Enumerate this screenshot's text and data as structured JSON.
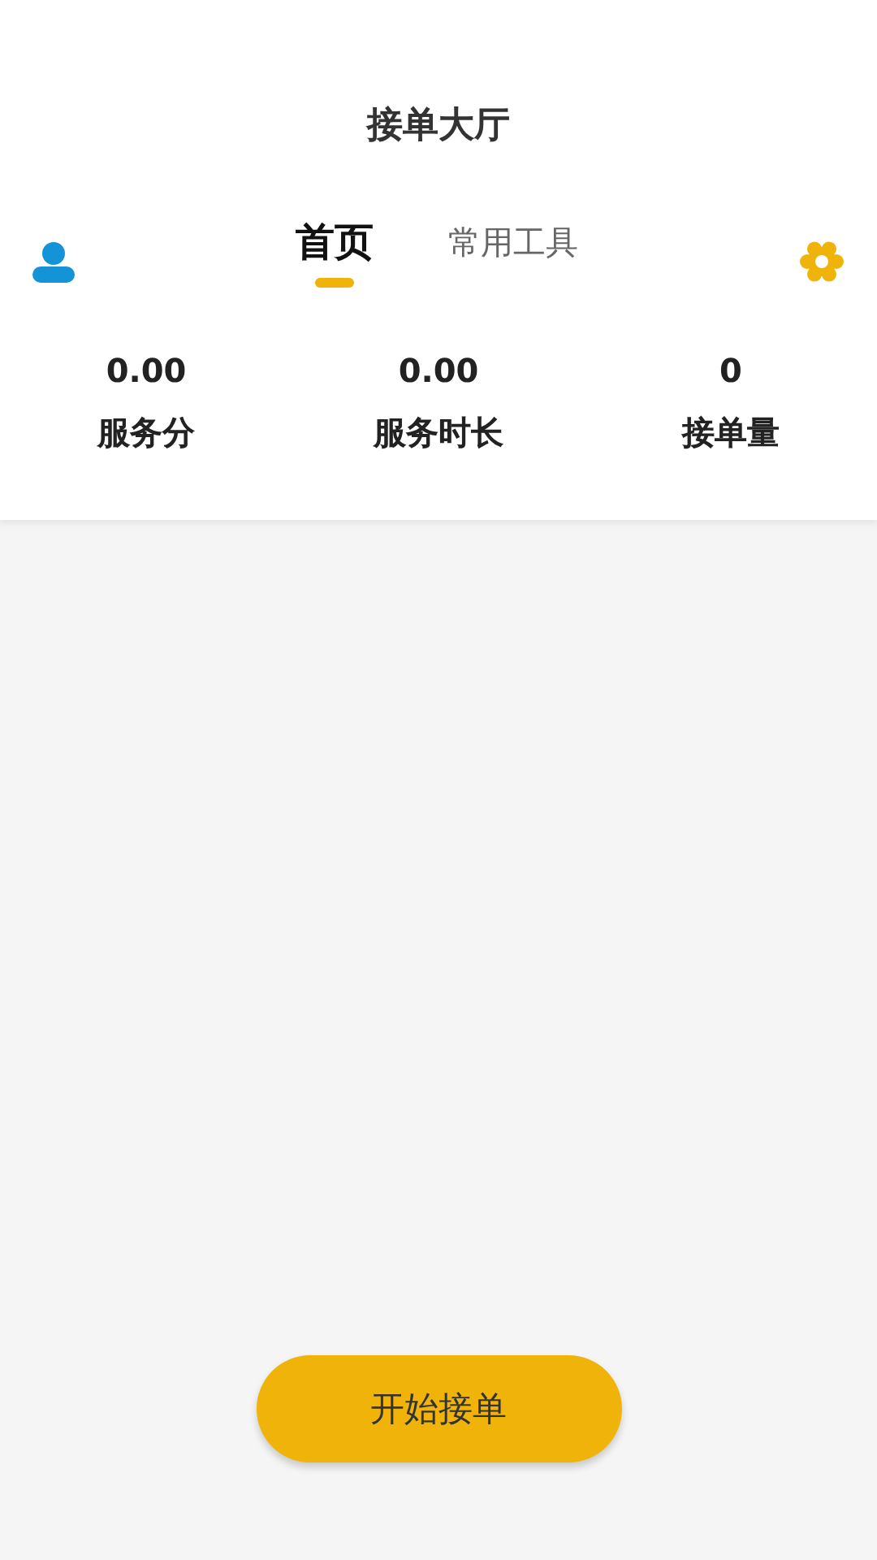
{
  "title": "接单大厅",
  "tabs": [
    {
      "label": "首页",
      "selected": true
    },
    {
      "label": "常用工具",
      "selected": false
    }
  ],
  "stats": [
    {
      "value": "0.00",
      "label": "服务分"
    },
    {
      "value": "0.00",
      "label": "服务时长"
    },
    {
      "value": "0",
      "label": "接单量"
    }
  ],
  "button": "开始接单"
}
